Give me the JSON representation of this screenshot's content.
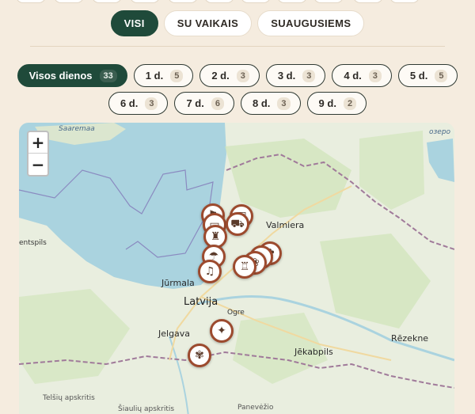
{
  "audience": {
    "buttons": [
      {
        "label": "VISI",
        "active": true
      },
      {
        "label": "SU VAIKAIS",
        "active": false
      },
      {
        "label": "SUAUGUSIEMS",
        "active": false
      }
    ]
  },
  "days": {
    "all": {
      "label": "Visos dienos",
      "count": "33"
    },
    "items": [
      {
        "label": "1 d.",
        "count": "5"
      },
      {
        "label": "2 d.",
        "count": "3"
      },
      {
        "label": "3 d.",
        "count": "3"
      },
      {
        "label": "4 d.",
        "count": "3"
      },
      {
        "label": "5 d.",
        "count": "5"
      },
      {
        "label": "6 d.",
        "count": "3"
      },
      {
        "label": "7 d.",
        "count": "6"
      },
      {
        "label": "8 d.",
        "count": "3"
      },
      {
        "label": "9 d.",
        "count": "2"
      }
    ]
  },
  "map": {
    "zoom_in": "+",
    "zoom_out": "−",
    "labels": {
      "saaremaa": "Saaremaa",
      "ventspils": "entspils",
      "jurmala": "Jūrmala",
      "latvija": "Latvija",
      "ogre": "Ogre",
      "jelgava": "Jelgava",
      "valmiera": "Valmiera",
      "jekabpils": "Jēkabpils",
      "rezekne": "Rēzekne",
      "telsiu": "Telšių apskritis",
      "siauliu": "Šiaulių apskritis",
      "panevezio": "Panevėžio",
      "ozero": "озеро"
    },
    "colors": {
      "water": "#aad3df",
      "land": "#e9eedf",
      "forest": "#cfe4b8",
      "pin_border": "#9c4a2e"
    }
  }
}
